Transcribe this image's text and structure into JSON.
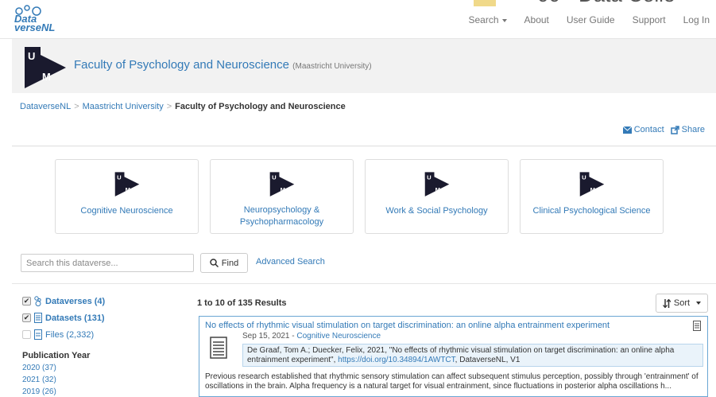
{
  "navbar": {
    "logo_line1": "Data",
    "logo_line2": "verseNL",
    "items": [
      "Search",
      "About",
      "User Guide",
      "Support",
      "Log In"
    ],
    "banner_text": "00 - Data Colle"
  },
  "header": {
    "title": "Faculty of Psychology and Neuroscience",
    "affiliation": "(Maastricht University)"
  },
  "breadcrumb": [
    "DataverseNL",
    "Maastricht University",
    "Faculty of Psychology and Neuroscience"
  ],
  "actions": {
    "contact": "Contact",
    "share": "Share"
  },
  "featured": [
    {
      "label": "Cognitive Neuroscience"
    },
    {
      "label": "Neuropsychology & Psychopharmacology"
    },
    {
      "label": "Work & Social Psychology"
    },
    {
      "label": "Clinical Psychological Science"
    }
  ],
  "search": {
    "placeholder": "Search this dataverse...",
    "find_label": "Find",
    "advanced_label": "Advanced Search"
  },
  "facets": {
    "types": [
      {
        "label": "Dataverses (4)",
        "checked": true
      },
      {
        "label": "Datasets (131)",
        "checked": true
      },
      {
        "label": "Files (2,332)",
        "checked": false
      }
    ],
    "pub_year_heading": "Publication Year",
    "years": [
      "2020 (37)",
      "2021 (32)",
      "2019 (26)"
    ]
  },
  "results": {
    "count_text": "1 to 10 of 135 Results",
    "sort_label": "Sort",
    "items": [
      {
        "title": "No effects of rhythmic visual stimulation on target discrimination: an online alpha entrainment experiment",
        "date": "Sep 15, 2021",
        "dataverse": "Cognitive Neuroscience",
        "citation_pre": "De Graaf, Tom A.; Duecker, Felix, 2021, \"No effects of rhythmic visual stimulation on target discrimination: an online alpha entrainment experiment\",",
        "doi": "https://doi.org/10.34894/1AWTCT",
        "citation_post": ", DataverseNL, V1",
        "abstract": "Previous research established that rhythmic sensory stimulation can affect subsequent stimulus perception, possibly through 'entrainment' of oscillations in the brain. Alpha frequency is a natural target for visual entrainment, since fluctuations in posterior alpha oscillations h..."
      }
    ]
  },
  "colors": {
    "link": "#337ab7",
    "header_bg": "#f2f2f2",
    "citation_bg": "#eaf3fa"
  }
}
